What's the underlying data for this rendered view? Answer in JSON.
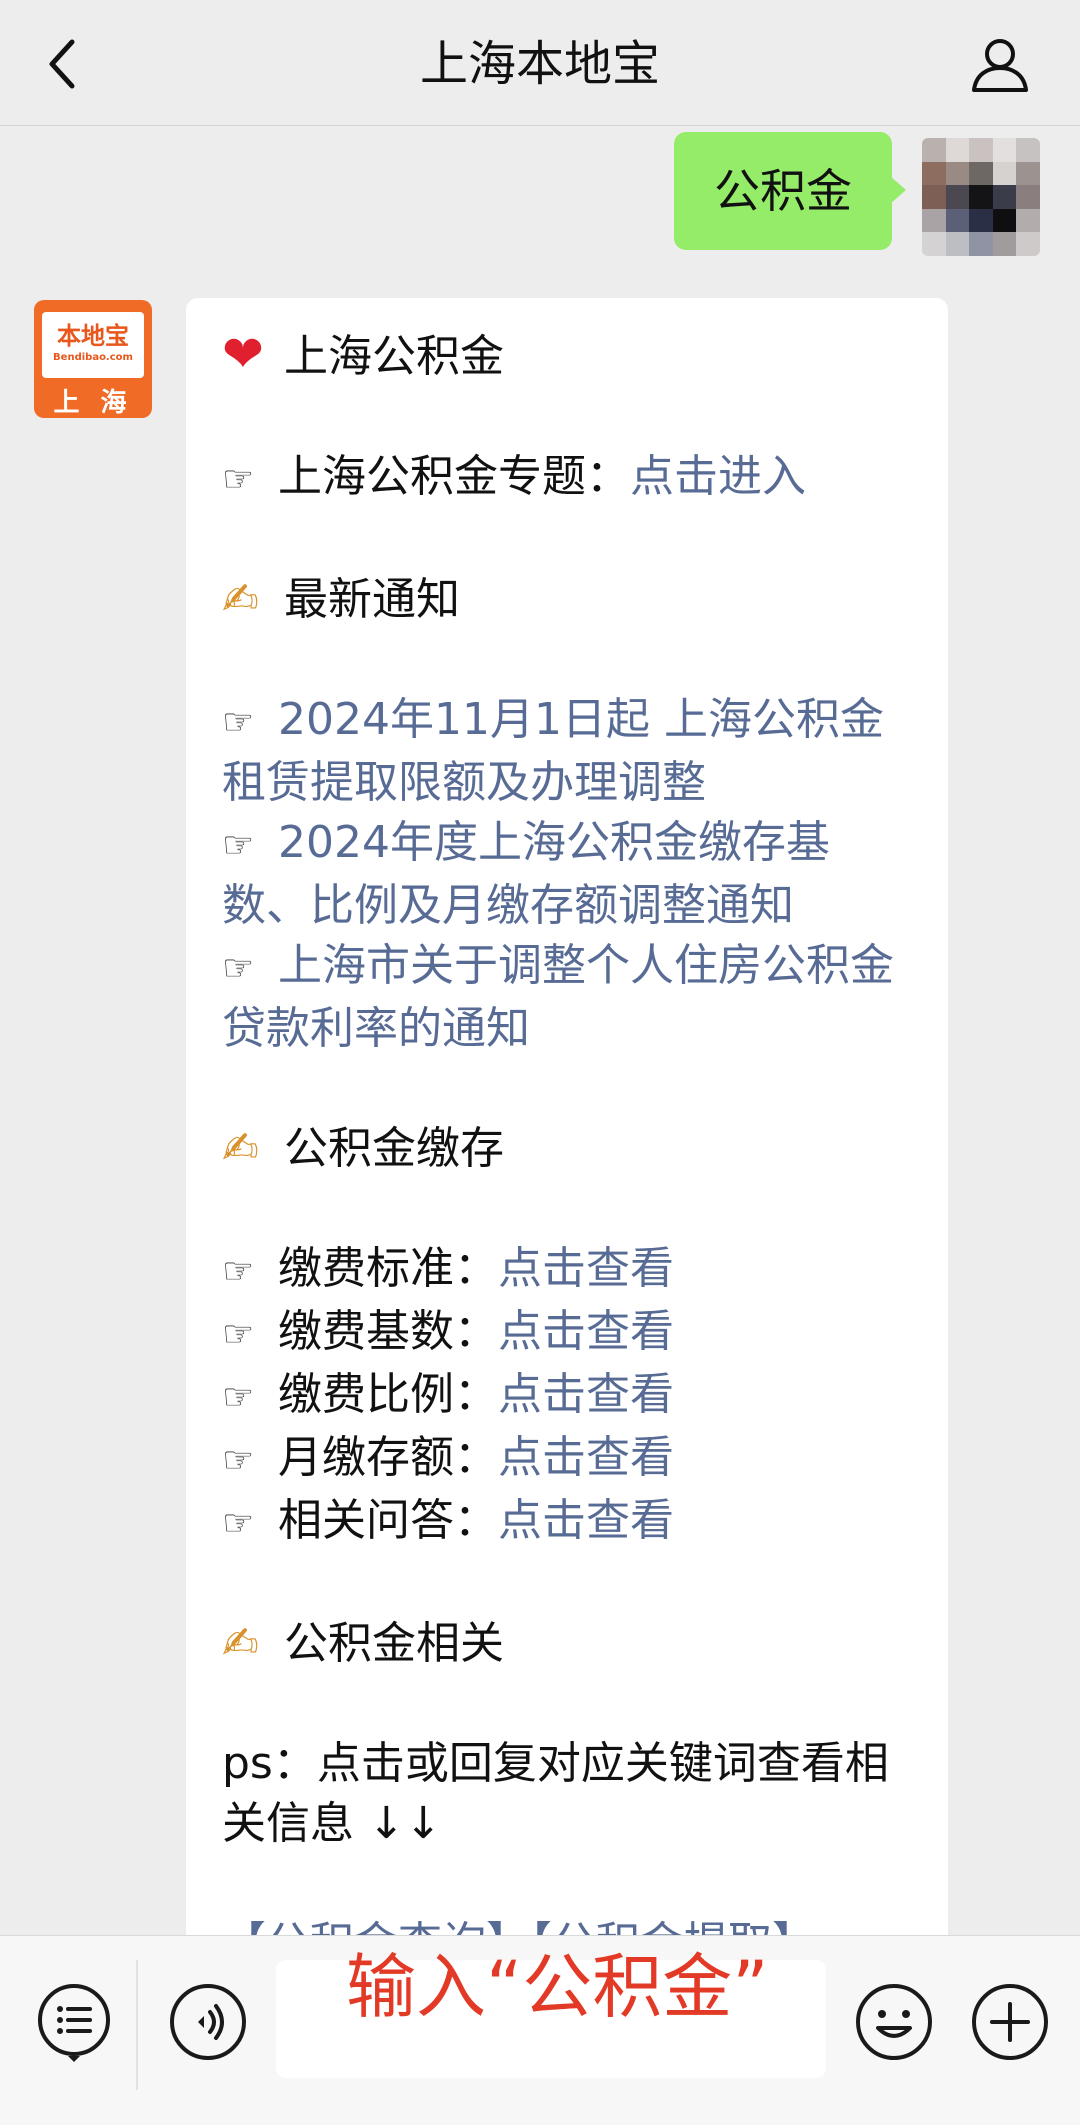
{
  "header": {
    "title": "上海本地宝"
  },
  "outgoing": {
    "text": "公积金"
  },
  "bot_avatar": {
    "brand": "本地宝",
    "url": "Bendibao.com",
    "city": "上 海"
  },
  "message": {
    "title": "上海公积金",
    "topic_label": "上海公积金专题：",
    "topic_link": "点击进入",
    "section_notice": "最新通知",
    "notices": [
      "2024年11月1日起 上海公积金租赁提取限额及办理调整",
      "2024年度上海公积金缴存基数、比例及月缴存额调整通知",
      "上海市关于调整个人住房公积金贷款利率的通知"
    ],
    "section_deposit": "公积金缴存",
    "deposit_items": [
      {
        "label": "缴费标准：",
        "link": "点击查看"
      },
      {
        "label": "缴费基数：",
        "link": "点击查看"
      },
      {
        "label": "缴费比例：",
        "link": "点击查看"
      },
      {
        "label": "月缴存额：",
        "link": "点击查看"
      },
      {
        "label": "相关问答：",
        "link": "点击查看"
      }
    ],
    "section_related": "公积金相关",
    "ps": "ps：点击或回复对应关键词查看相关信息 ↓↓",
    "keywords": "【公积金查询】【公积金提取】"
  },
  "overlay_hint": "输入“公积金”",
  "colors": {
    "link": "#576b95",
    "bubble_out": "#95ec69",
    "overlay": "#e23a26"
  }
}
